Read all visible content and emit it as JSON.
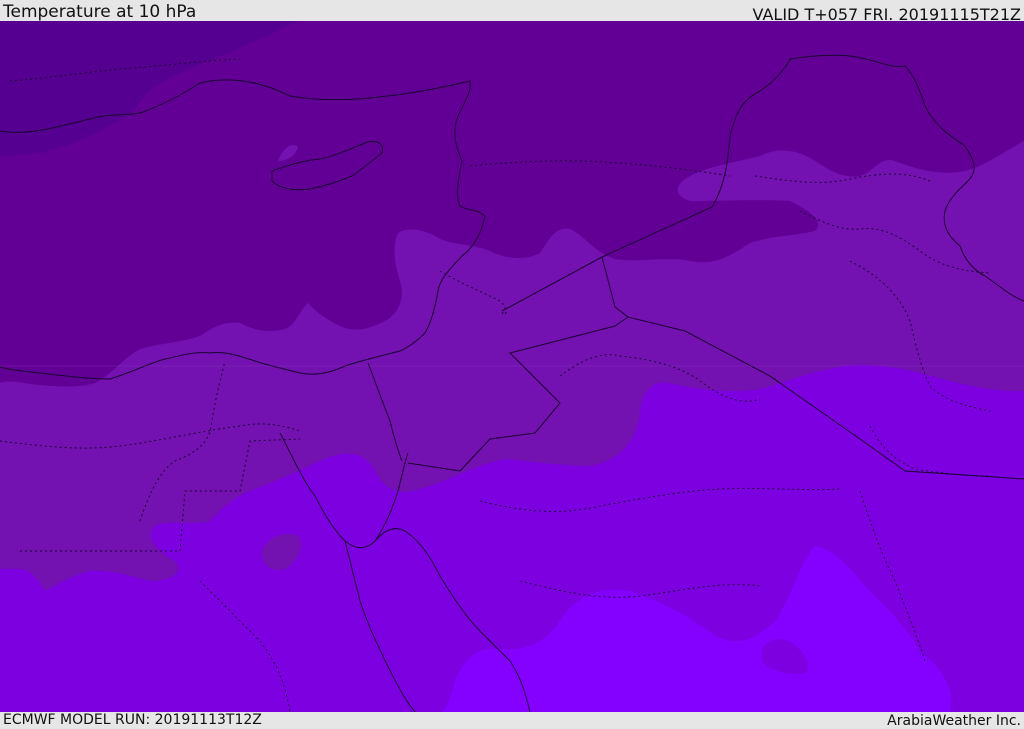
{
  "header": {
    "title": "Temperature at 10 hPa",
    "valid": "VALID T+057 FRI. 20191115T21Z"
  },
  "footer": {
    "model_run": "ECMWF MODEL RUN: 20191113T12Z",
    "credit": "ArabiaWeather Inc."
  },
  "colors": {
    "band_darkest": "#550090",
    "band_dark": "#620096",
    "band_mid": "#7312b0",
    "band_light": "#7c00e0",
    "band_lightest": "#8400ff",
    "border": "#1a0030"
  }
}
